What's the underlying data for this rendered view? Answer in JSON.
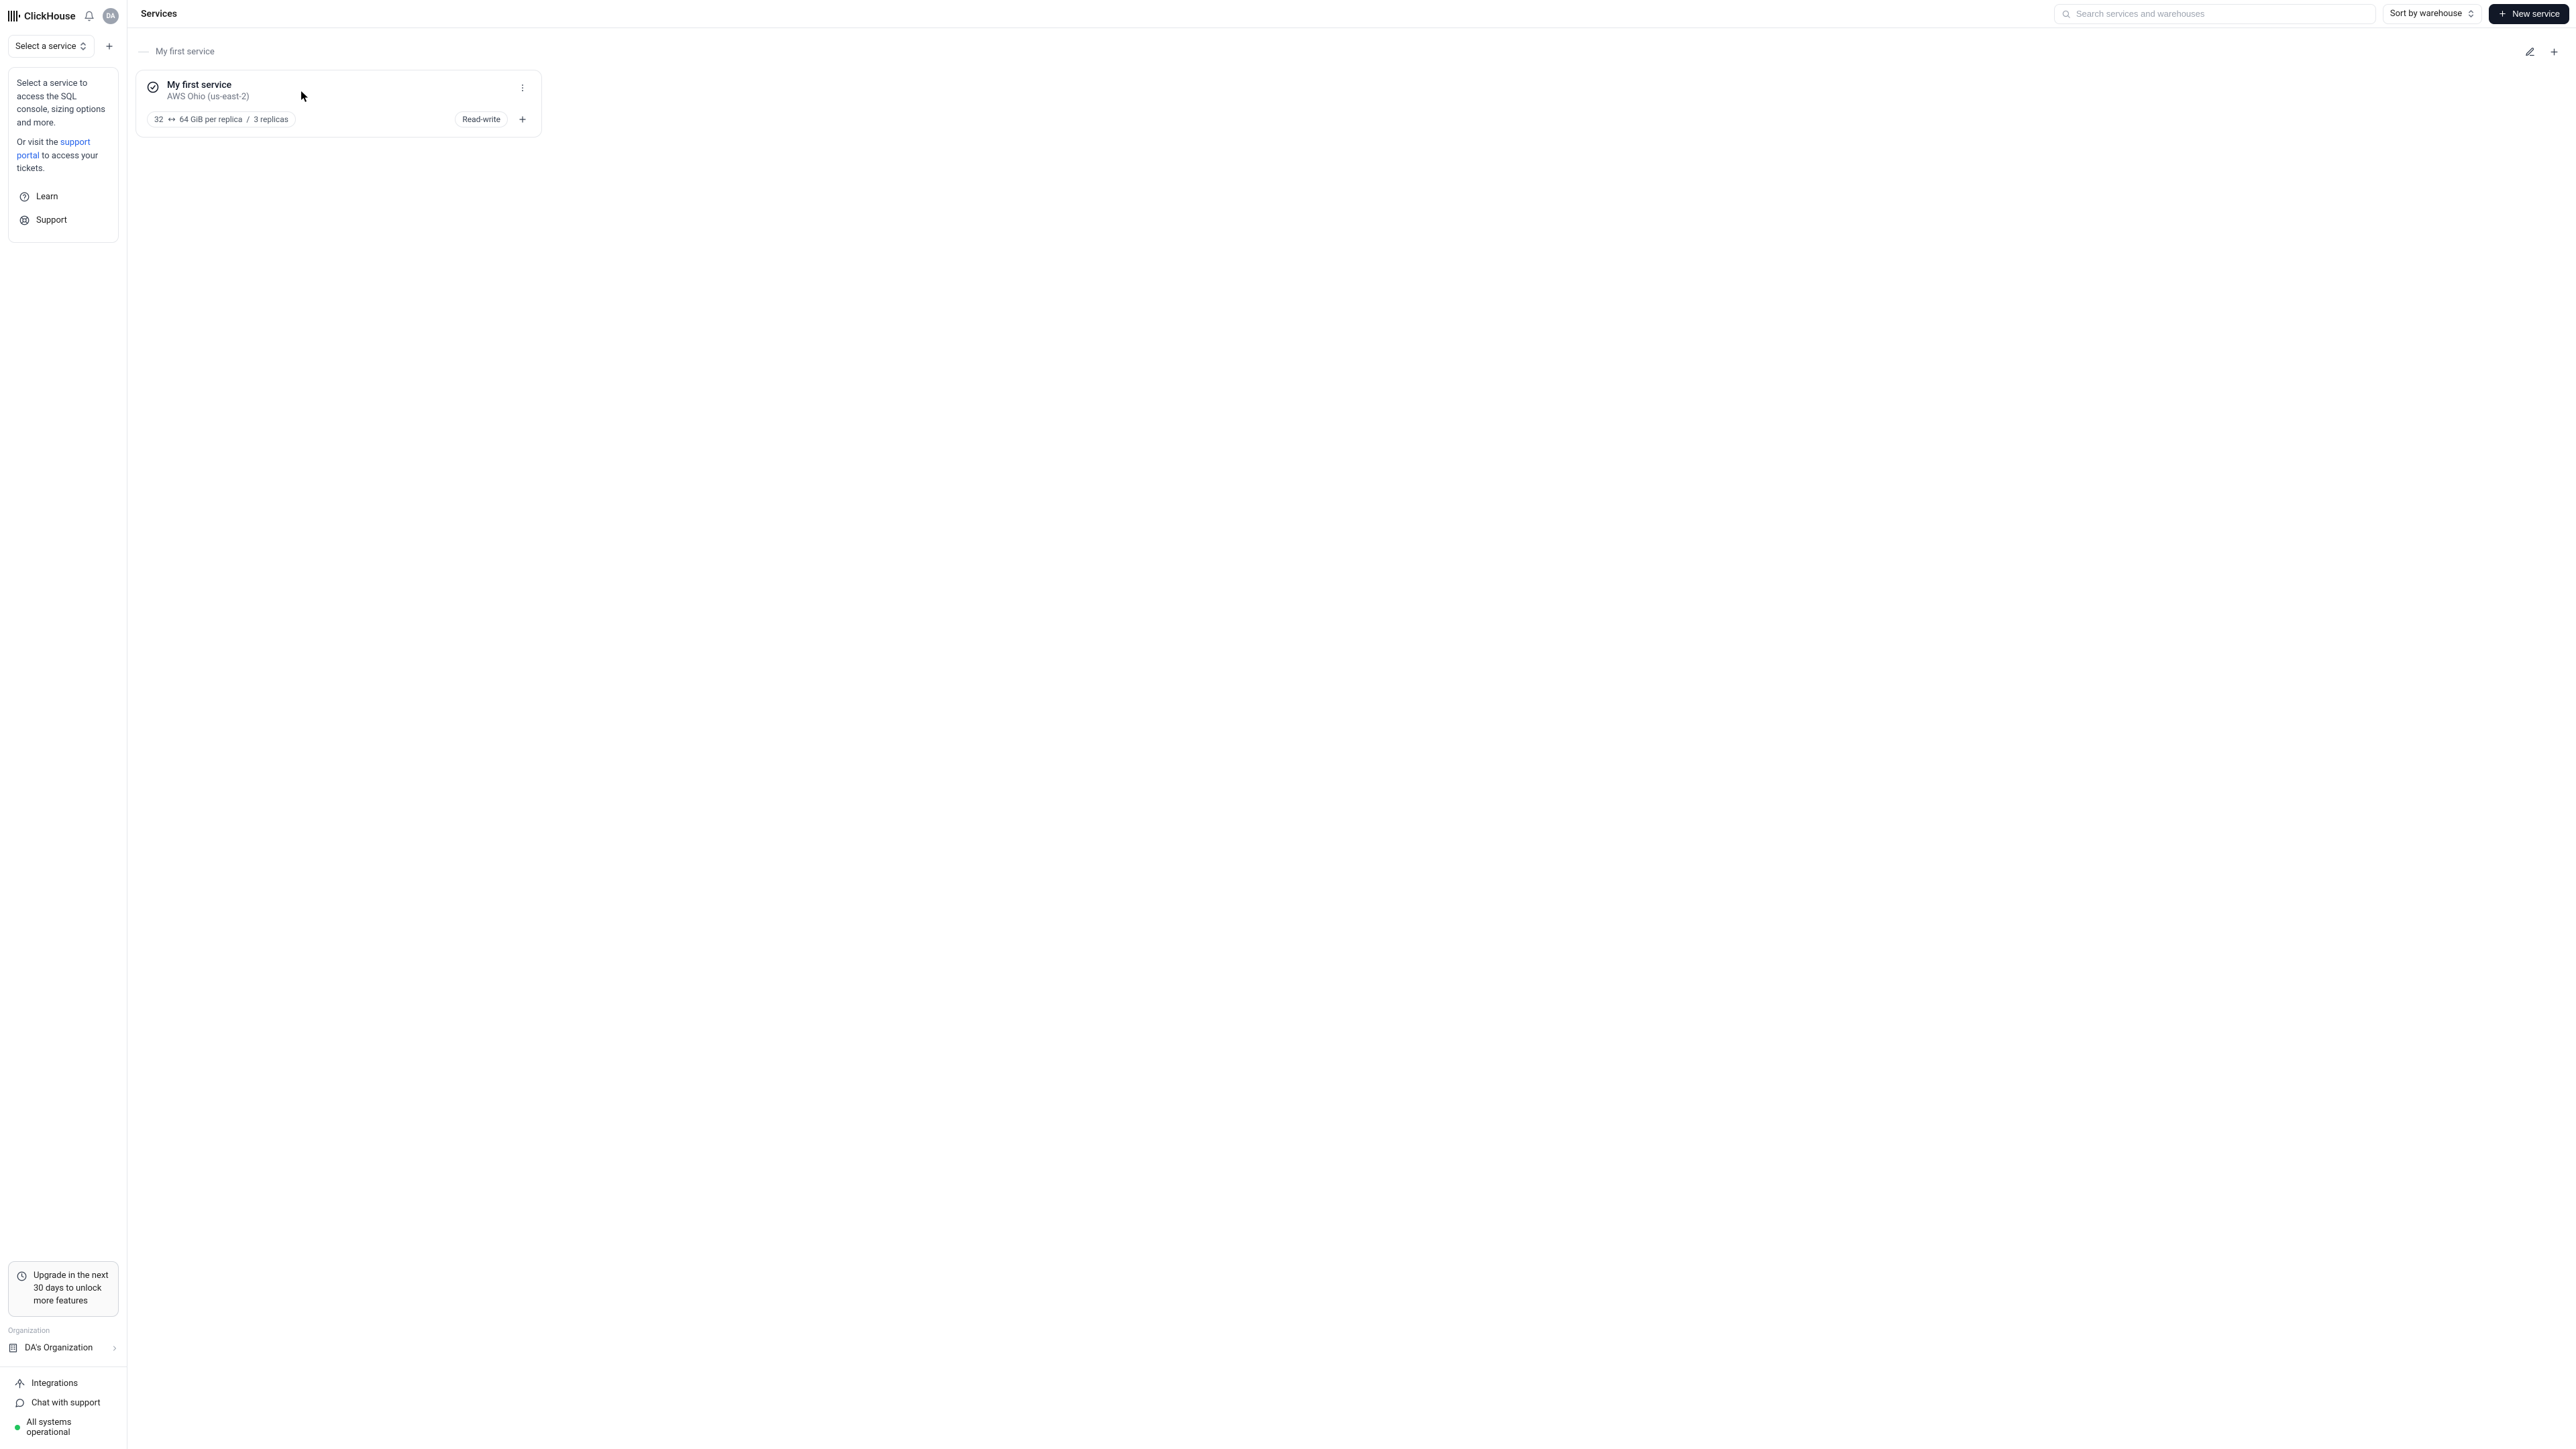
{
  "brand": {
    "name": "ClickHouse"
  },
  "user": {
    "initials": "DA"
  },
  "sidebar": {
    "select_label": "Select a service",
    "info_text_1": "Select a service to access the SQL console, sizing options and more.",
    "info_text_2a": "Or visit the ",
    "support_link": "support portal",
    "info_text_2b": " to access your tickets.",
    "learn_label": "Learn",
    "support_label": "Support",
    "upgrade_text": "Upgrade in the next 30 days to unlock more features",
    "org_section_label": "Organization",
    "org_name": "DA's Organization",
    "integrations_label": "Integrations",
    "chat_label": "Chat with support",
    "status_label": "All systems operational"
  },
  "topbar": {
    "title": "Services",
    "search_placeholder": "Search services and warehouses",
    "sort_label": "Sort by warehouse",
    "new_service_label": "New service"
  },
  "group": {
    "title": "My first service"
  },
  "service": {
    "name": "My first service",
    "location": "AWS Ohio (us-east-2)",
    "size_min": "32",
    "size_max": "64 GiB per replica",
    "replicas": "3 replicas",
    "mode": "Read-write"
  }
}
